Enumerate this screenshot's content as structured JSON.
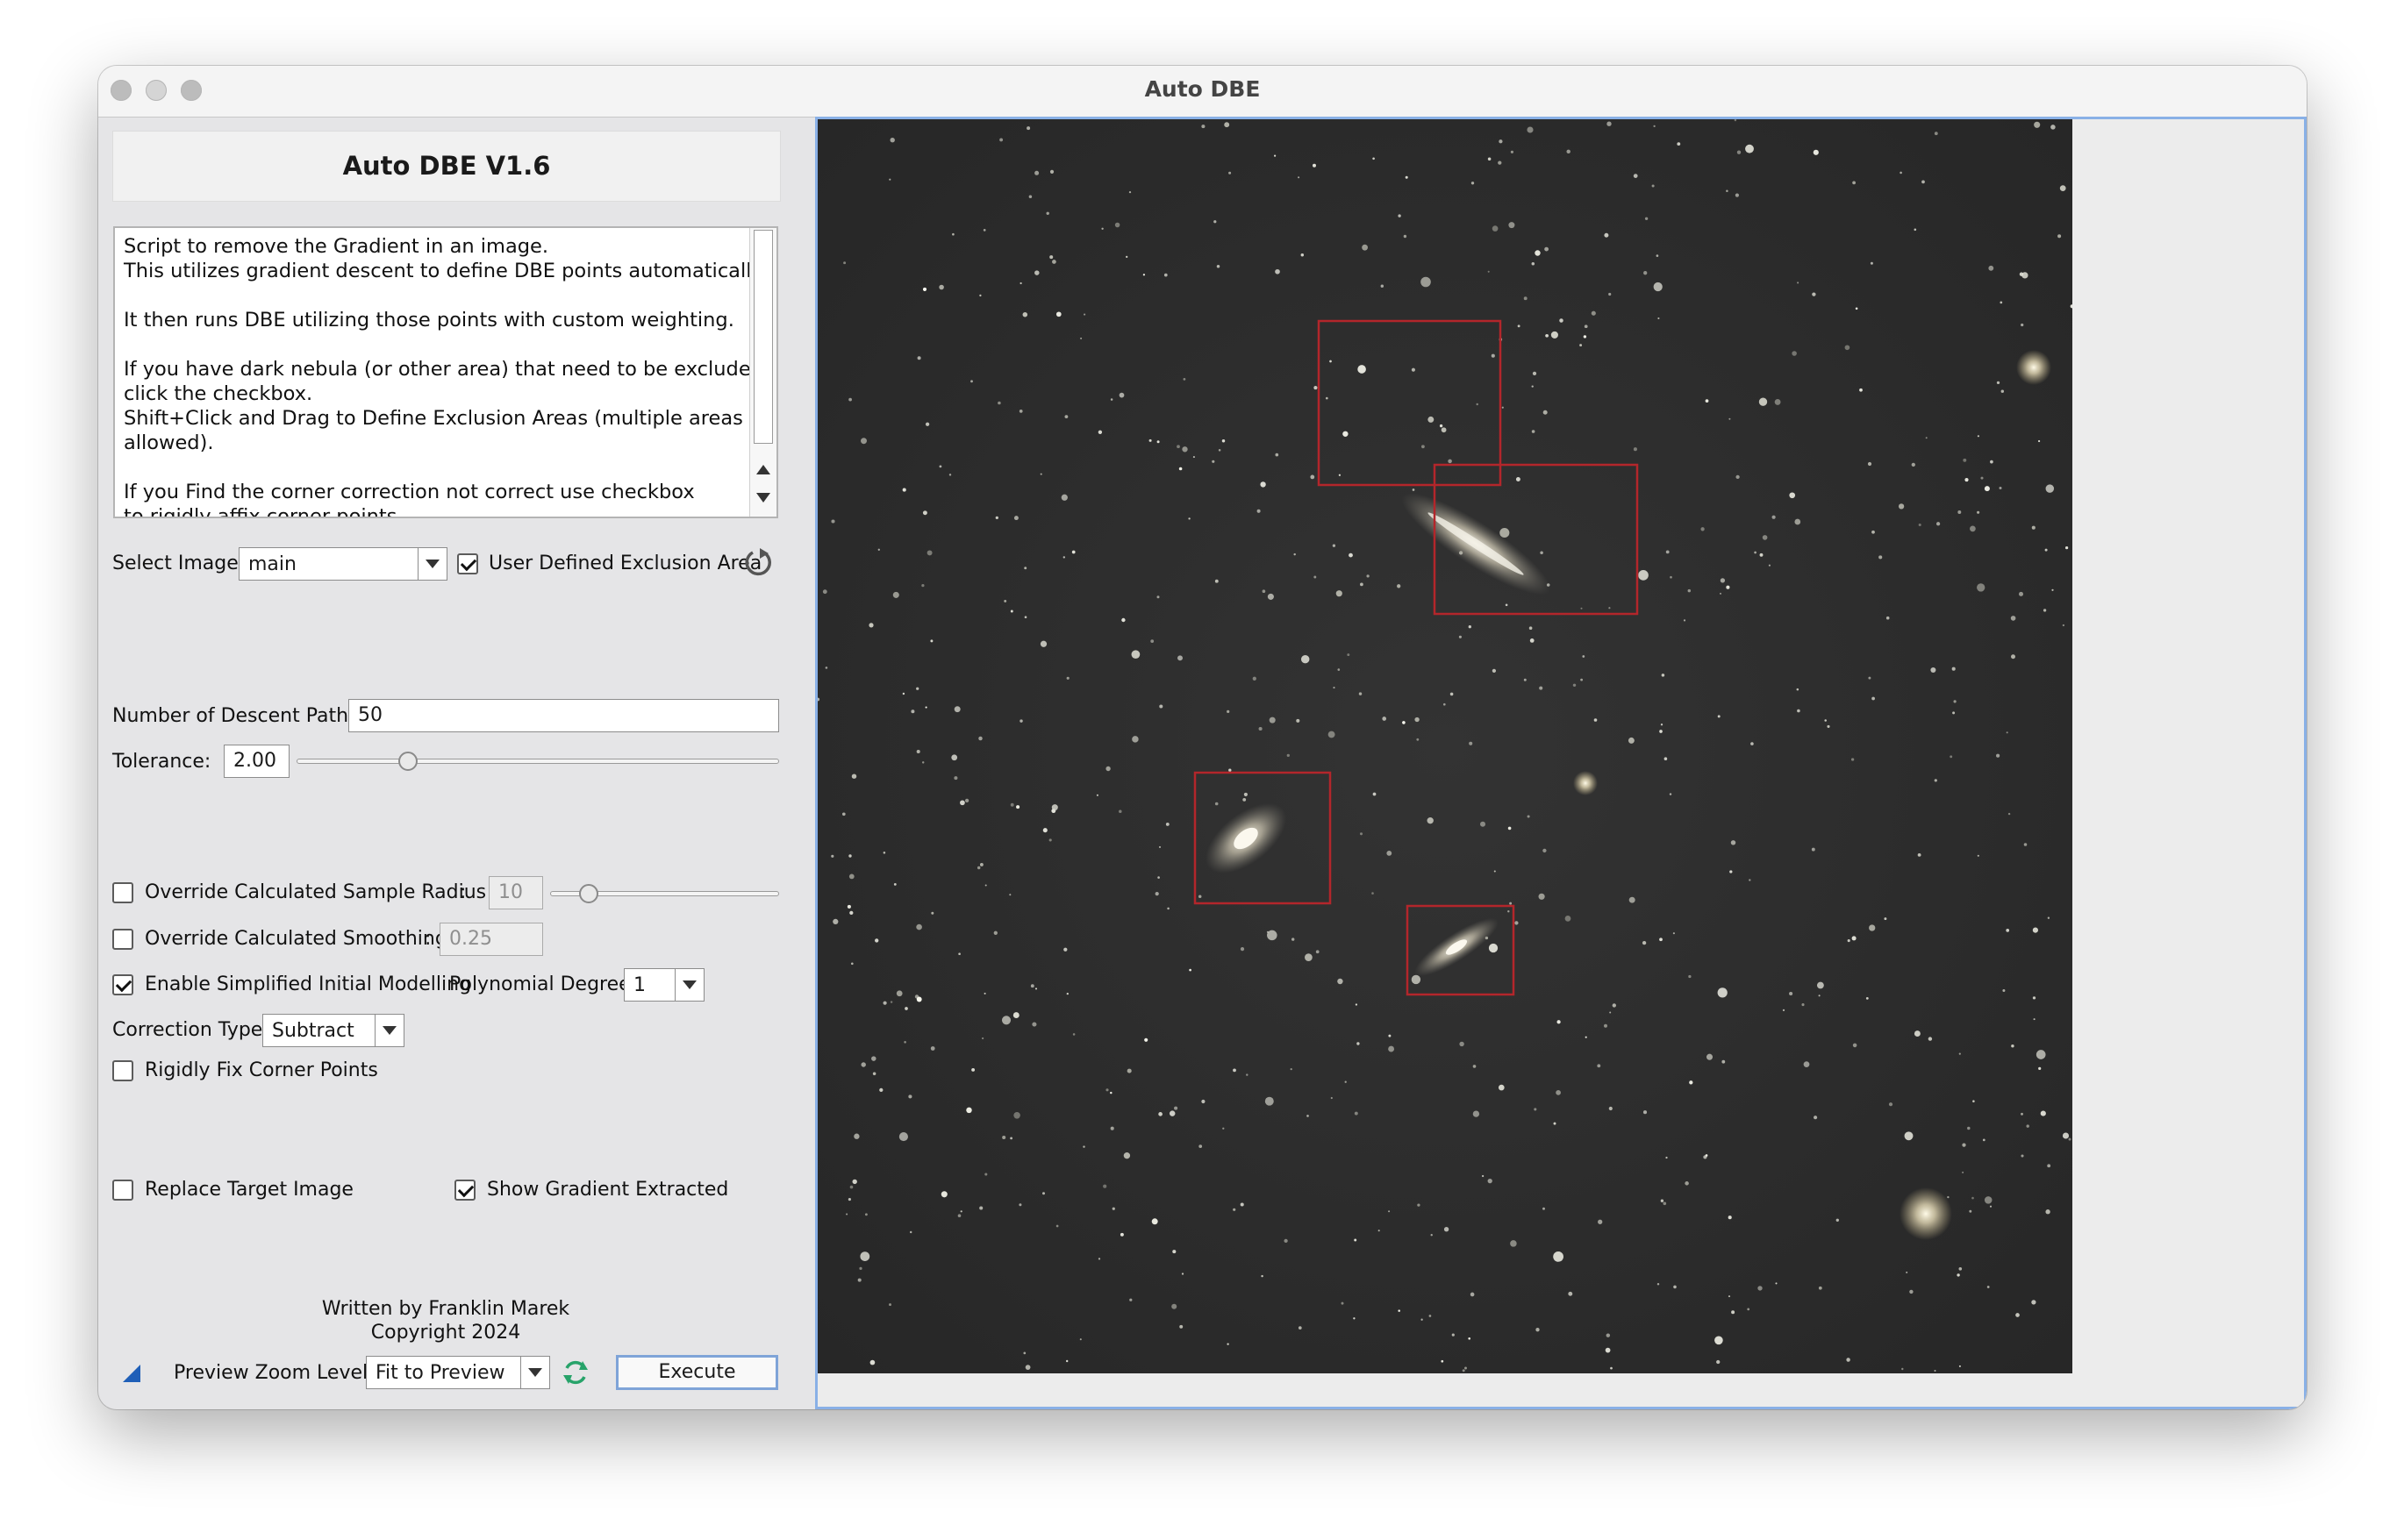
{
  "window": {
    "title": "Auto DBE"
  },
  "header": {
    "title": "Auto DBE V1.6"
  },
  "description": {
    "lines": [
      "Script to remove the Gradient in an image.",
      "This utilizes gradient descent to define DBE points automatically.",
      "",
      "It then runs DBE utilizing those points with custom weighting.",
      "",
      "If you have dark nebula (or other area) that need to be excluded",
      "click the checkbox.",
      "Shift+Click and Drag to Define Exclusion Areas (multiple areas",
      "allowed).",
      "",
      "If you Find the corner correction not correct use checkbox",
      " to rigidly affix corner points."
    ]
  },
  "select_image": {
    "label": "Select Image:",
    "value": "main"
  },
  "user_defined_exclusion": {
    "label": "User Defined Exclusion Area",
    "checked": true
  },
  "descent_paths": {
    "label": "Number of Descent Paths:",
    "value": "50"
  },
  "tolerance": {
    "label": "Tolerance:",
    "value": "2.00",
    "slider_fraction": 0.23
  },
  "override_radius": {
    "label": "Override Calculated Sample Radius",
    "colon": ":",
    "value": "10",
    "checked": false,
    "slider_fraction": 0.17
  },
  "override_smoothing": {
    "label": "Override Calculated Smoothing",
    "colon": ":",
    "value": "0.25",
    "checked": false
  },
  "simplified_modelling": {
    "label": "Enable Simplified Initial Modelling",
    "checked": true
  },
  "polynomial_degree": {
    "label": "Polynomial Degree:",
    "value": "1"
  },
  "correction_type": {
    "label": "Correction Type:",
    "value": "Subtract"
  },
  "rigid_corners": {
    "label": "Rigidly Fix Corner Points",
    "checked": false
  },
  "replace_target": {
    "label": "Replace Target Image",
    "checked": false
  },
  "show_gradient": {
    "label": "Show Gradient Extracted",
    "checked": true
  },
  "footer": {
    "author": "Written by Franklin Marek",
    "copyright": "Copyright 2024"
  },
  "zoom": {
    "label": "Preview Zoom Level:",
    "value": "Fit to Preview"
  },
  "execute_label": "Execute",
  "colors": {
    "accent": "#89b0e6",
    "exclusion_box": "#b3262b",
    "sky": "#2a2a2a"
  }
}
